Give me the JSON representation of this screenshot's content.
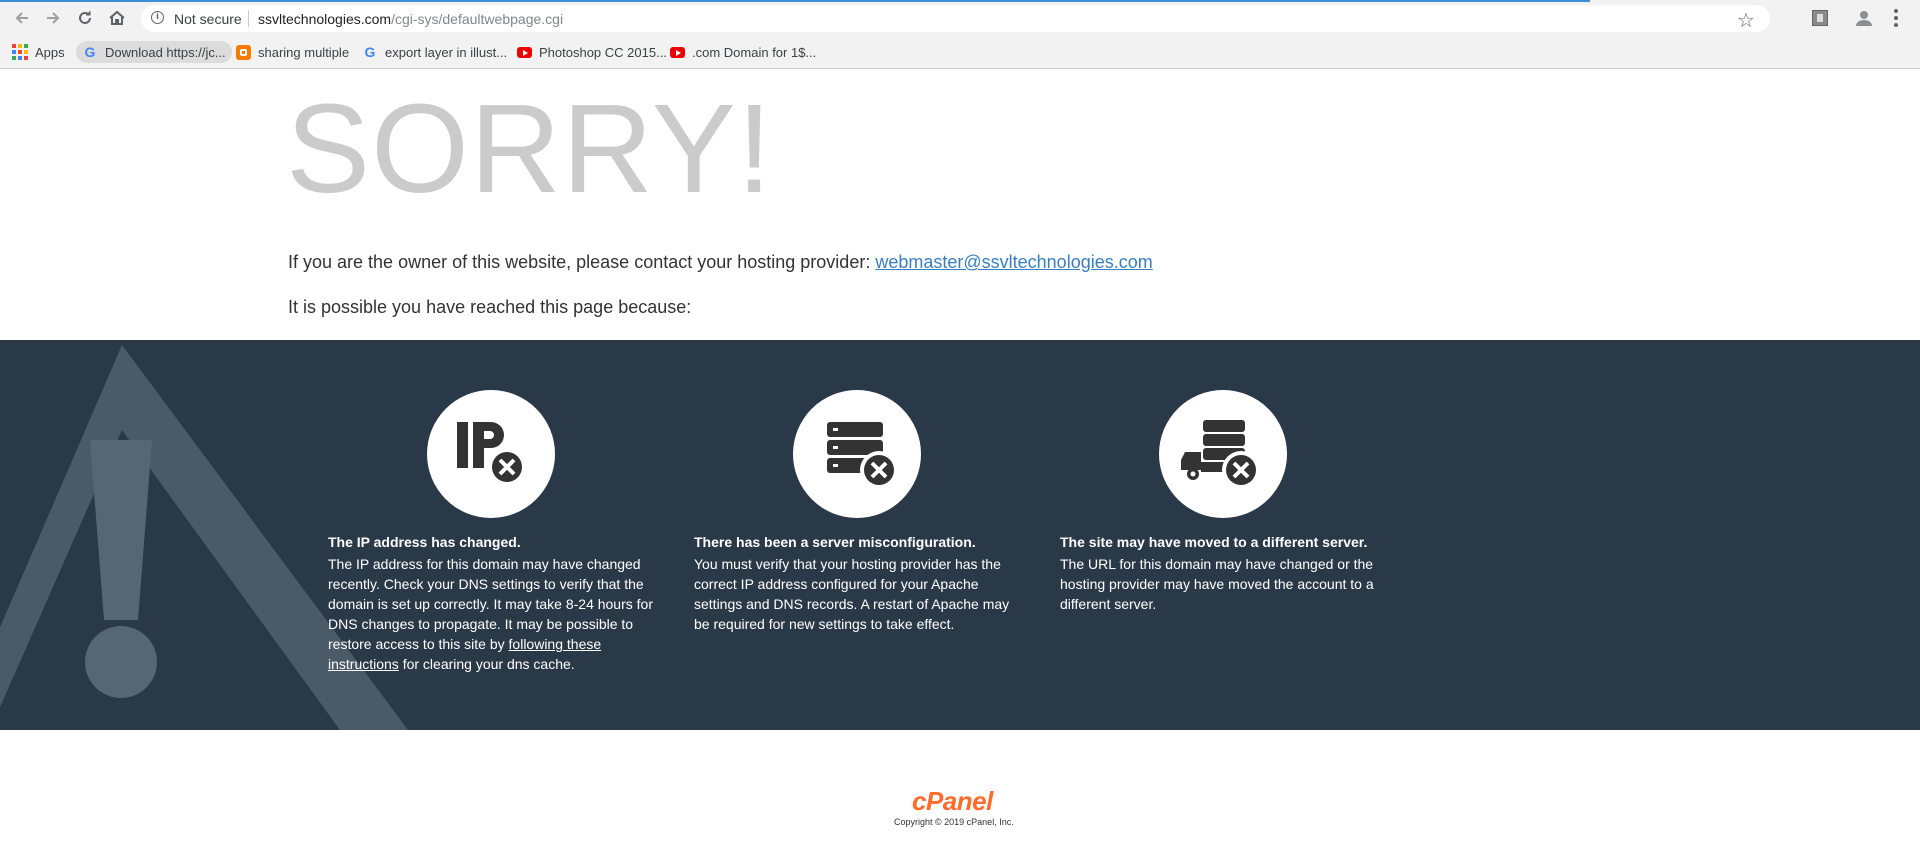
{
  "browser": {
    "security_label": "Not secure",
    "url_domain": "ssvltechnologies.com",
    "url_path": "/cgi-sys/defaultwebpage.cgi",
    "bookmarks": [
      {
        "label": "Apps",
        "icon": "apps-grid-icon"
      },
      {
        "label": "Download https://jc...",
        "icon": "google-icon"
      },
      {
        "label": "sharing multiple",
        "icon": "blogger-icon"
      },
      {
        "label": "export layer in illust...",
        "icon": "google-icon"
      },
      {
        "label": "Photoshop CC 2015...",
        "icon": "youtube-icon"
      },
      {
        "label": ".com Domain for 1$...",
        "icon": "youtube-icon"
      }
    ]
  },
  "page": {
    "heading": "SORRY!",
    "owner_text": "If you are the owner of this website, please contact your hosting provider:",
    "contact_email": "webmaster@ssvltechnologies.com",
    "reason_intro": "It is possible you have reached this page because:",
    "reasons": [
      {
        "icon": "ip-error-icon",
        "title": "The IP address has changed.",
        "body": "The IP address for this domain may have changed recently. Check your DNS settings to verify that the domain is set up correctly. It may take 8-24 hours for DNS changes to propagate. It may be possible to restore access to this site by",
        "link": "following these instructions",
        "body_after": "for clearing your dns cache."
      },
      {
        "icon": "server-error-icon",
        "title": "There has been a server misconfiguration.",
        "body": "You must verify that your hosting provider has the correct IP address configured for your Apache settings and DNS records. A restart of Apache may be required for new settings to take effect."
      },
      {
        "icon": "server-moved-icon",
        "title": "The site may have moved to a different server.",
        "body": "The URL for this domain may have changed or the hosting provider may have moved the account to a different server."
      }
    ]
  },
  "footer": {
    "logo": "cPanel",
    "copyright": "Copyright © 2019 cPanel, Inc."
  }
}
